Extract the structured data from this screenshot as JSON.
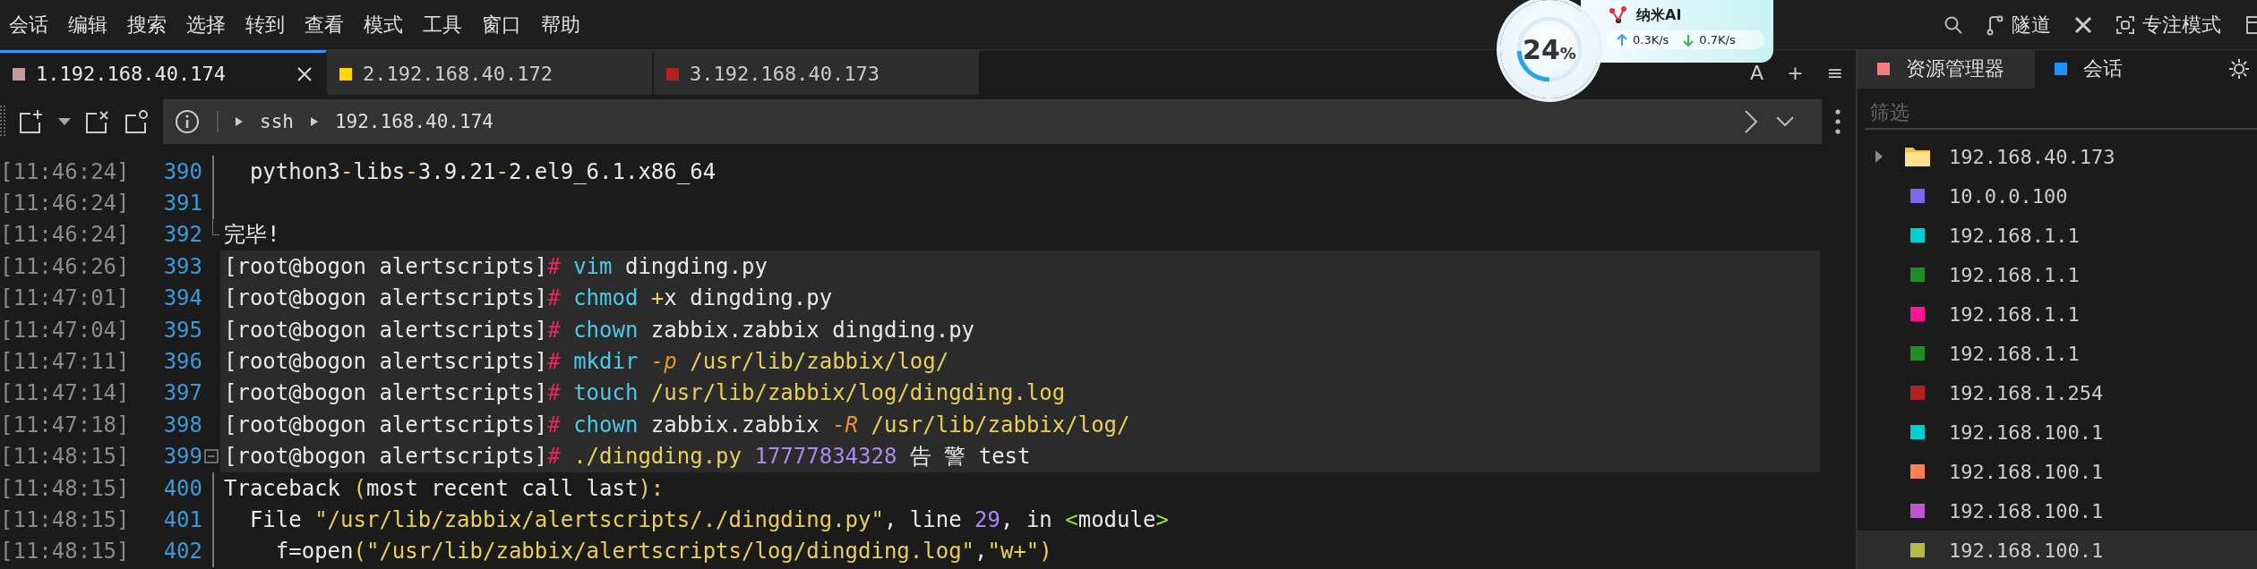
{
  "menu": [
    "会话",
    "编辑",
    "搜索",
    "选择",
    "转到",
    "查看",
    "模式",
    "工具",
    "窗口",
    "帮助"
  ],
  "topbar": {
    "tunnel": "隧道",
    "focus": "专注模式"
  },
  "widget": {
    "percent": "24",
    "unit": "%",
    "level": 0.24,
    "name": "纳米AI",
    "upload": "0.3K/s",
    "download": "0.7K/s"
  },
  "tabs": [
    {
      "label": "1.192.168.40.174",
      "color": "#c49a9a",
      "selected": true
    },
    {
      "label": "2.192.168.40.172",
      "color": "#ffd700",
      "selected": false
    },
    {
      "label": "3.192.168.40.173",
      "color": "#b22222",
      "selected": false
    }
  ],
  "tab_actions": [
    "A",
    "+",
    "≡"
  ],
  "address": {
    "protocol": "ssh",
    "host": "192.168.40.174"
  },
  "terminal": [
    {
      "time": "[11:46:24]",
      "num": "390",
      "kind": "fold_line",
      "highlighted": false,
      "parts": [
        {
          "t": "  python3",
          "kind": "plain"
        },
        {
          "t": "-",
          "kind": "string"
        },
        {
          "t": "libs",
          "kind": "plain"
        },
        {
          "t": "-",
          "kind": "string"
        },
        {
          "t": "3.9.21",
          "kind": "plain"
        },
        {
          "t": "-",
          "kind": "string"
        },
        {
          "t": "2.el9_6.1.x86_64",
          "kind": "plain"
        }
      ]
    },
    {
      "time": "[11:46:24]",
      "num": "391",
      "kind": "fold_line",
      "highlighted": false
    },
    {
      "time": "[11:46:24]",
      "num": "392",
      "kind": "fold_end",
      "highlighted": false,
      "parts": [
        {
          "t": "完毕!",
          "kind": "plain"
        }
      ]
    },
    {
      "time": "[11:46:26]",
      "num": "393",
      "kind": "plain",
      "highlighted": true,
      "parts": [
        {
          "t": "[root@bogon alertscripts]",
          "kind": "plain"
        },
        {
          "t": "#",
          "kind": "prompt"
        },
        {
          "t": " vim",
          "kind": "command"
        },
        {
          "t": " dingding.py",
          "kind": "plain"
        }
      ]
    },
    {
      "time": "[11:47:01]",
      "num": "394",
      "kind": "plain",
      "highlighted": true,
      "parts": [
        {
          "t": "[root@bogon alertscripts]",
          "kind": "plain"
        },
        {
          "t": "#",
          "kind": "prompt"
        },
        {
          "t": " chmod",
          "kind": "command"
        },
        {
          "t": " +",
          "kind": "string"
        },
        {
          "t": "x dingding.py",
          "kind": "plain"
        }
      ]
    },
    {
      "time": "[11:47:04]",
      "num": "395",
      "kind": "plain",
      "highlighted": true,
      "parts": [
        {
          "t": "[root@bogon alertscripts]",
          "kind": "plain"
        },
        {
          "t": "#",
          "kind": "prompt"
        },
        {
          "t": " chown",
          "kind": "command"
        },
        {
          "t": " zabbix.zabbix dingding.py",
          "kind": "plain"
        }
      ]
    },
    {
      "time": "[11:47:11]",
      "num": "396",
      "kind": "plain",
      "highlighted": true,
      "parts": [
        {
          "t": "[root@bogon alertscripts]",
          "kind": "plain"
        },
        {
          "t": "#",
          "kind": "prompt"
        },
        {
          "t": " mkdir",
          "kind": "command"
        },
        {
          "t": " -p",
          "kind": "flag"
        },
        {
          "t": " /usr/lib/zabbix/log/",
          "kind": "string"
        }
      ]
    },
    {
      "time": "[11:47:14]",
      "num": "397",
      "kind": "plain",
      "highlighted": true,
      "parts": [
        {
          "t": "[root@bogon alertscripts]",
          "kind": "plain"
        },
        {
          "t": "#",
          "kind": "prompt"
        },
        {
          "t": " touch",
          "kind": "command"
        },
        {
          "t": " /usr/lib/zabbix/log/dingding.log",
          "kind": "string"
        }
      ]
    },
    {
      "time": "[11:47:18]",
      "num": "398",
      "kind": "plain",
      "highlighted": true,
      "parts": [
        {
          "t": "[root@bogon alertscripts]",
          "kind": "plain"
        },
        {
          "t": "#",
          "kind": "prompt"
        },
        {
          "t": " chown",
          "kind": "command"
        },
        {
          "t": " zabbix.zabbix ",
          "kind": "plain"
        },
        {
          "t": "-R",
          "kind": "flag"
        },
        {
          "t": " /usr/lib/zabbix/log/",
          "kind": "string"
        }
      ]
    },
    {
      "time": "[11:48:15]",
      "num": "399",
      "kind": "fold_toggle",
      "highlighted": true,
      "parts": [
        {
          "t": "[root@bogon alertscripts]",
          "kind": "plain"
        },
        {
          "t": "#",
          "kind": "prompt"
        },
        {
          "t": " ./dingding.py",
          "kind": "string"
        },
        {
          "t": " 17777834328",
          "kind": "number"
        },
        {
          "t": " 告 警 test",
          "kind": "plain"
        }
      ]
    },
    {
      "time": "[11:48:15]",
      "num": "400",
      "kind": "fold_line",
      "highlighted": false,
      "parts": [
        {
          "t": "Traceback ",
          "kind": "plain"
        },
        {
          "t": "(",
          "kind": "string"
        },
        {
          "t": "most recent call last",
          "kind": "plain"
        },
        {
          "t": "):",
          "kind": "string"
        }
      ]
    },
    {
      "time": "[11:48:15]",
      "num": "401",
      "kind": "fold_line",
      "highlighted": false,
      "parts": [
        {
          "t": "  File ",
          "kind": "plain"
        },
        {
          "t": "\"/usr/lib/zabbix/alertscripts/./dingding.py\"",
          "kind": "string"
        },
        {
          "t": ", line ",
          "kind": "plain"
        },
        {
          "t": "29",
          "kind": "number"
        },
        {
          "t": ", in ",
          "kind": "plain"
        },
        {
          "t": "<",
          "kind": "tag"
        },
        {
          "t": "module",
          "kind": "plain"
        },
        {
          "t": ">",
          "kind": "tag"
        }
      ]
    },
    {
      "time": "[11:48:15]",
      "num": "402",
      "kind": "fold_line",
      "highlighted": false,
      "parts": [
        {
          "t": "    f=open",
          "kind": "plain"
        },
        {
          "t": "(\"/usr/lib/zabbix/alertscripts/log/dingding.log\"",
          "kind": "string"
        },
        {
          "t": ",",
          "kind": "plain"
        },
        {
          "t": "\"w+\")",
          "kind": "string"
        }
      ]
    }
  ],
  "sidebar": {
    "tabs": [
      {
        "label": "资源管理器",
        "color": "#f08080",
        "selected": true
      },
      {
        "label": "会话",
        "color": "#1e90ff",
        "selected": false
      }
    ],
    "filter": {
      "placeholder": "筛选"
    },
    "items": [
      {
        "kind": "folder",
        "label": "192.168.40.173",
        "expanded": false,
        "selected": false
      },
      {
        "kind": "host",
        "label": "10.0.0.100",
        "color": "#7b68ee",
        "selected": false
      },
      {
        "kind": "host",
        "label": "192.168.1.1",
        "color": "#00ced1",
        "selected": false
      },
      {
        "kind": "host",
        "label": "192.168.1.1",
        "color": "#228b22",
        "selected": false
      },
      {
        "kind": "host",
        "label": "192.168.1.1",
        "color": "#ff1493",
        "selected": false
      },
      {
        "kind": "host",
        "label": "192.168.1.1",
        "color": "#228b22",
        "selected": false
      },
      {
        "kind": "host",
        "label": "192.168.1.254",
        "color": "#b22222",
        "selected": false
      },
      {
        "kind": "host",
        "label": "192.168.100.1",
        "color": "#00ced1",
        "selected": false
      },
      {
        "kind": "host",
        "label": "192.168.100.1",
        "color": "#ff7f50",
        "selected": false
      },
      {
        "kind": "host",
        "label": "192.168.100.1",
        "color": "#ba55d3",
        "selected": false
      },
      {
        "kind": "host",
        "label": "192.168.100.1",
        "color": "#b5b84a",
        "selected": true
      }
    ]
  }
}
